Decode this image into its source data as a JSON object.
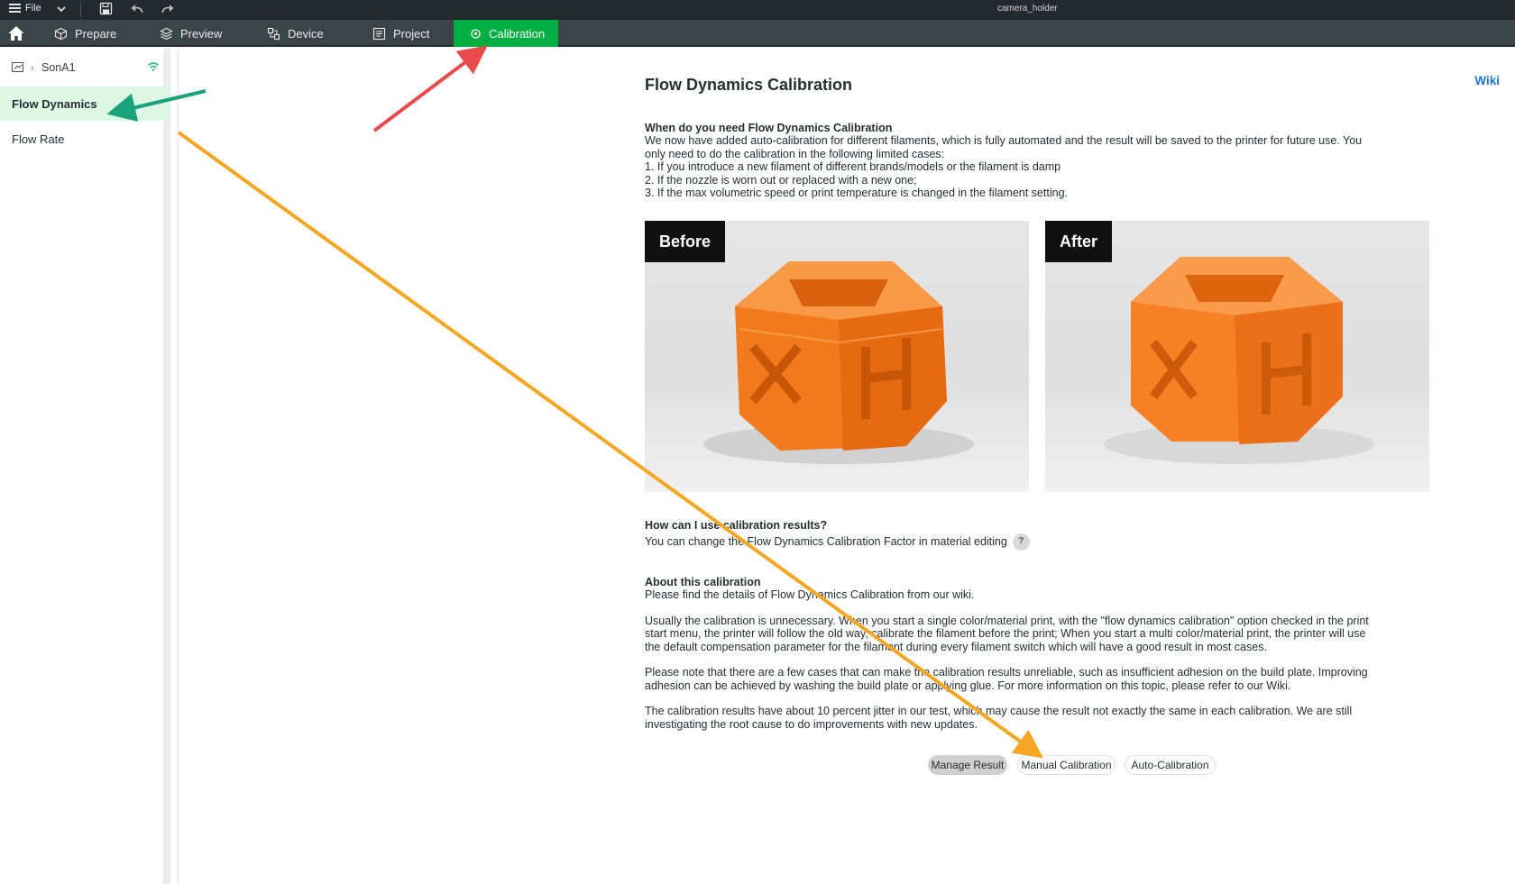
{
  "titlebar": {
    "file_label": "File",
    "window_title": "camera_holder"
  },
  "tabs": [
    {
      "label": "Prepare"
    },
    {
      "label": "Preview"
    },
    {
      "label": "Device"
    },
    {
      "label": "Project"
    },
    {
      "label": "Calibration"
    }
  ],
  "active_tab": "Calibration",
  "colors": {
    "accent": "#00ae42",
    "link": "#1976d2",
    "selected_bg": "#dcf7e4"
  },
  "sidebar": {
    "printer_name": "SonA1",
    "items": [
      {
        "label": "Flow Dynamics"
      },
      {
        "label": "Flow Rate"
      }
    ]
  },
  "main": {
    "title": "Flow Dynamics Calibration",
    "wiki_label": "Wiki",
    "when_heading": "When do you need Flow Dynamics Calibration",
    "when_lines": [
      "We now have added auto-calibration for different filaments, which is fully automated and the result will be saved to the printer for future use. You",
      "only need to do the calibration in the following limited cases:",
      "1. If you introduce a new filament of different brands/models or the filament is damp",
      "2. If the nozzle is worn out or replaced with a new one;",
      "3. If the max volumetric speed or print temperature is changed in the filament setting."
    ],
    "before_label": "Before",
    "after_label": "After",
    "how_heading": "How can I use calibration results?",
    "how_text": "You can change the Flow Dynamics Calibration Factor in material editing",
    "help_glyph": "?",
    "about_heading": "About this calibration",
    "about_p1": "Please find the details of Flow Dynamics Calibration from our wiki.",
    "about_p2_lines": [
      "Usually the calibration is unnecessary. When you start a single color/material print, with the \"flow dynamics calibration\" option checked in the print",
      "start menu, the printer will follow the old way, calibrate the filament before the print; When you start a multi color/material print, the printer will use",
      "the default compensation parameter for the filament during every filament switch which will have a good result in most cases."
    ],
    "about_p3_lines": [
      "Please note that there are a few cases that can make the calibration results unreliable, such as insufficient adhesion on the build plate. Improving",
      "adhesion can be achieved by washing the build plate or applying glue. For more information on this topic, please refer to our Wiki."
    ],
    "about_p4_lines": [
      "The calibration results have about 10 percent jitter in our test, which may cause the result not exactly the same in each calibration. We are still",
      "investigating the root cause to do improvements with new updates."
    ],
    "buttons": {
      "manage": "Manage Result",
      "manual": "Manual Calibration",
      "auto": "Auto-Calibration"
    }
  },
  "annotations": {
    "arrow_colors": [
      "#e84b4b",
      "#1aa37a",
      "#f5a623"
    ]
  }
}
